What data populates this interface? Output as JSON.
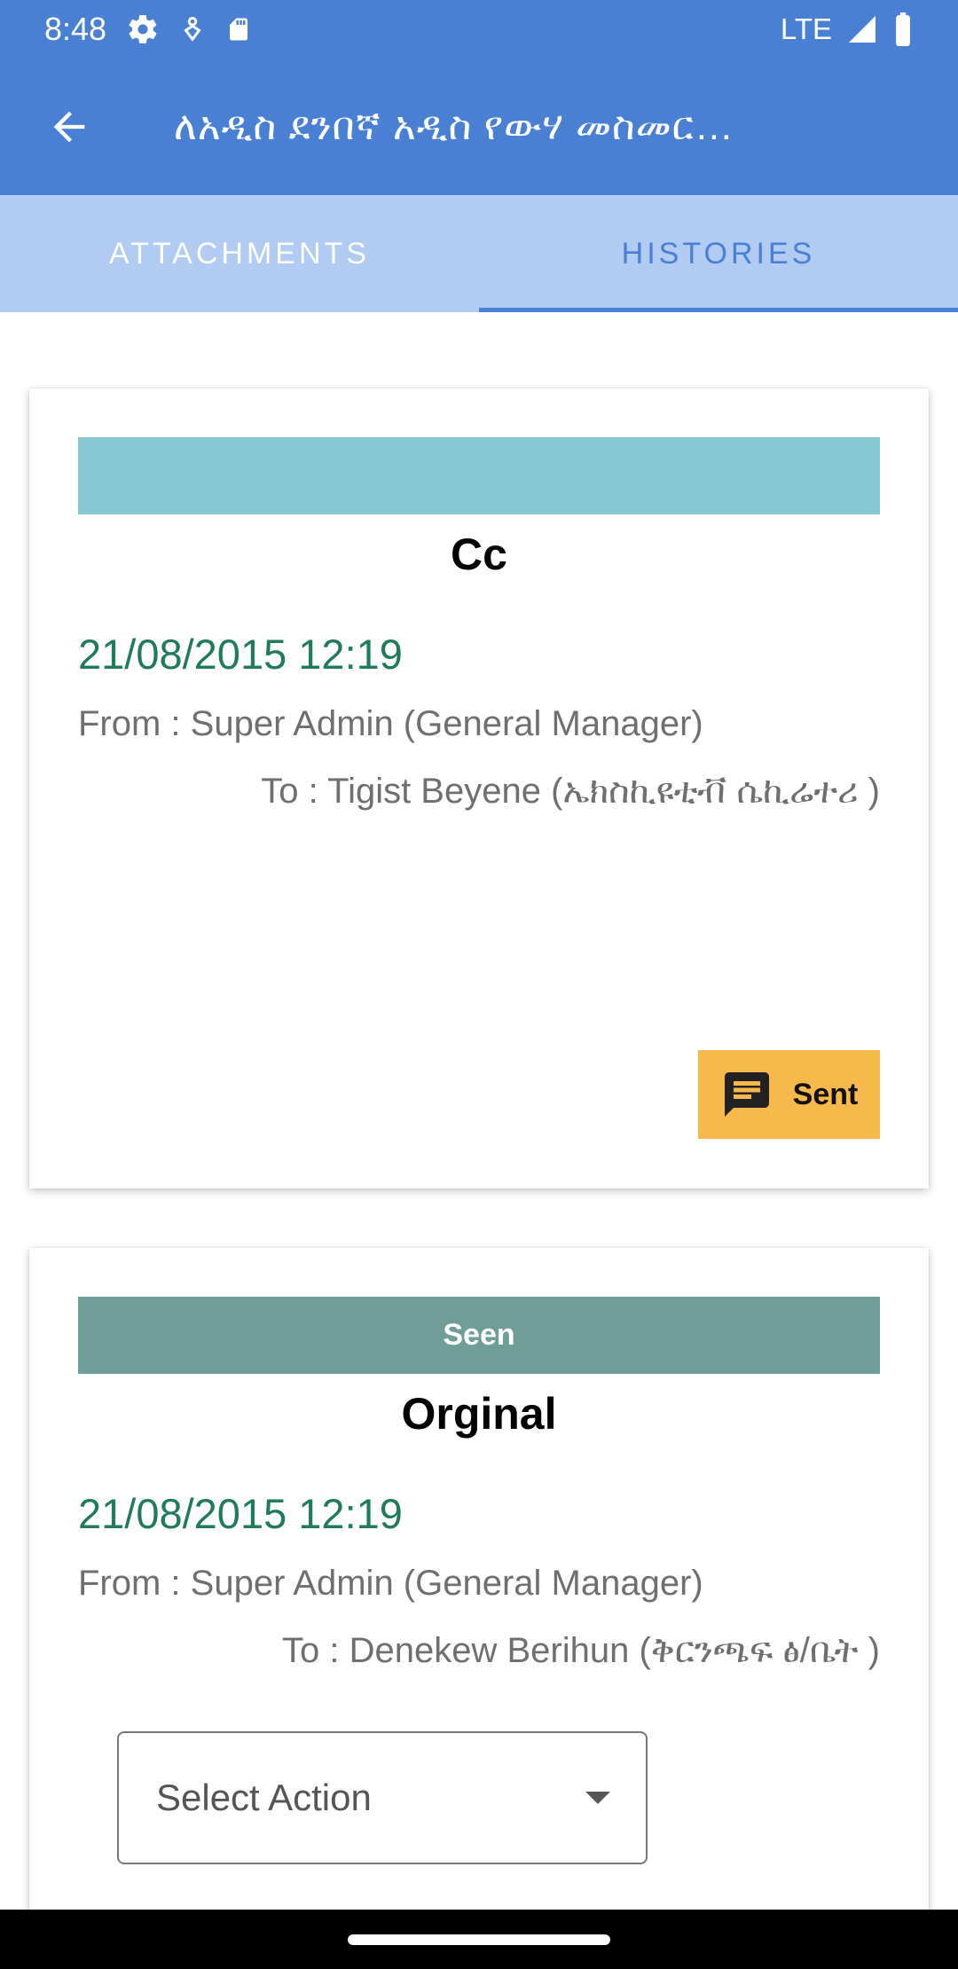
{
  "status_bar": {
    "time": "8:48",
    "network": "LTE",
    "icons": [
      "settings-gear-icon",
      "accessibility-icon",
      "sd-card-icon",
      "signal-icon",
      "battery-icon"
    ]
  },
  "app_bar": {
    "title": "ለአዲስ ደንበኛ አዲስ የውሃ መስመር…",
    "back_icon": "arrow-back-icon"
  },
  "tabs": [
    {
      "label": "ATTACHMENTS",
      "active": false
    },
    {
      "label": "HISTORIES",
      "active": true
    }
  ],
  "histories": [
    {
      "status": "",
      "status_color": "#87c8d2",
      "type": "Cc",
      "date": "21/08/2015 12:19",
      "from": "From : Super Admin (General Manager)",
      "to": "To : Tigist Beyene (ኤክስኪዩቲቭ ሴኪሬተሪ )",
      "action_label": "Sent",
      "action_color": "#f7b84c",
      "action_icon": "message-icon"
    },
    {
      "status": "Seen",
      "status_color": "#6f9e98",
      "type": "Orginal",
      "date": "21/08/2015 12:19",
      "from": "From : Super Admin (General Manager)",
      "to": "To : Denekew Berihun (ቅርንጫፍ ፅ/ቤት )",
      "select_placeholder": "Select Action"
    }
  ],
  "colors": {
    "primary": "#4a80d4",
    "tab_bg": "#b1cbf3",
    "date_green": "#207a5c"
  }
}
